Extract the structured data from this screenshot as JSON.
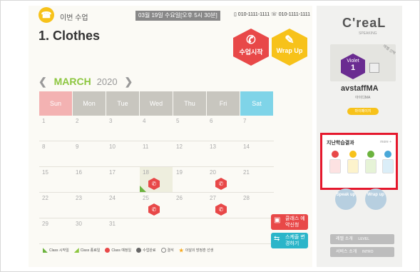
{
  "header": {
    "lesson_label": "이번 수업",
    "lesson_title": "1. Clothes",
    "datetime": "03월 19일 수요일[오후 5시 30분]",
    "phone1": "010-1111-1111",
    "phone2": "010-1111-1111"
  },
  "actions": {
    "start_label": "수업시작",
    "wrapup_label": "Wrap Up"
  },
  "calendar": {
    "month": "MARCH",
    "year": "2020",
    "days": [
      "Sun",
      "Mon",
      "Tue",
      "Wed",
      "Thu",
      "Fri",
      "Sat"
    ],
    "weeks": [
      [
        "1",
        "2",
        "3",
        "4",
        "5",
        "6",
        "7"
      ],
      [
        "8",
        "9",
        "10",
        "11",
        "12",
        "13",
        "14"
      ],
      [
        "15",
        "16",
        "17",
        "18",
        "19",
        "20",
        "21"
      ],
      [
        "22",
        "23",
        "24",
        "25",
        "26",
        "27",
        "28"
      ],
      [
        "29",
        "30",
        "31",
        "",
        "",
        "",
        ""
      ]
    ]
  },
  "side_buttons": {
    "class_label": "클래스 예약신청",
    "schedule_label": "스케줄 변경하기"
  },
  "legend": {
    "items": [
      "Class 시작일",
      "Class 종료일",
      "Class 예정일",
      "수업완료",
      "결석",
      "이달의 방정훈 선생"
    ]
  },
  "sidebar": {
    "logo": "C'reaL",
    "logo_sub": "SPEAKING",
    "level_option": "레벨 선택",
    "level_name": "Violet",
    "level_num": "1",
    "username": "avstaffMA",
    "username_sub": "아이디MA",
    "mypage_label": "마이페이지",
    "results_title": "지난학습결과",
    "results_more": "more +",
    "speak_up_label": "Speak up",
    "wrap_up_label": "Wrap up",
    "level_intro_label": "레벨 소개",
    "level_intro_en": "LEVEL",
    "service_intro_label": "서비스 소개",
    "service_intro_en": "INTRO"
  }
}
